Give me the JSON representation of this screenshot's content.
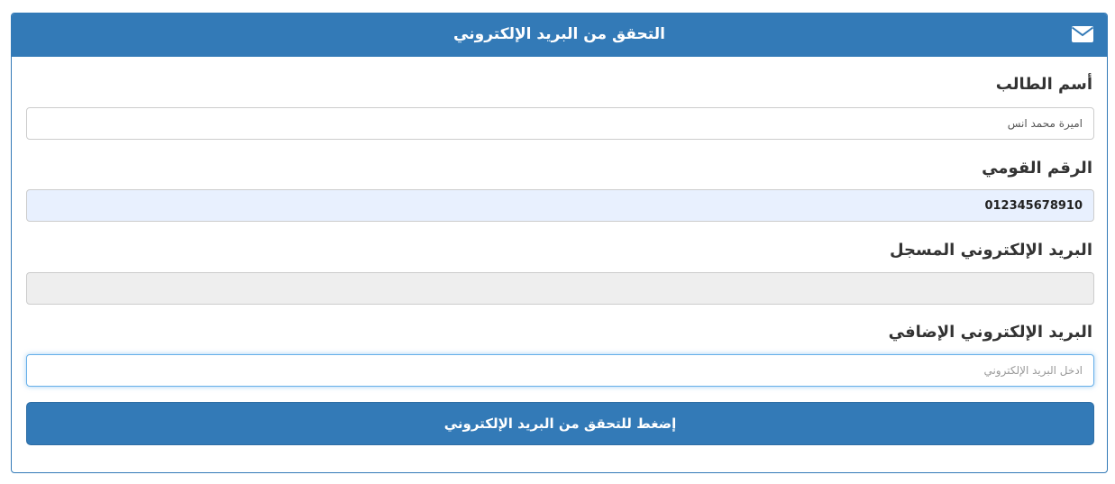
{
  "panel": {
    "title": "التحقق من البريد الإلكتروني",
    "header_icon": "envelope-icon",
    "accent_color": "#337ab7"
  },
  "form": {
    "student_name": {
      "label": "أسم الطالب",
      "value": "اميرة محمد انس"
    },
    "national_id": {
      "label": "الرقم القومي",
      "value": "012345678910"
    },
    "registered_email": {
      "label": "البريد الإلكتروني المسجل",
      "value": ""
    },
    "additional_email": {
      "label": "البريد الإلكتروني الإضافي",
      "value": "",
      "placeholder": "ادخل البريد الإلكتروني"
    },
    "submit_label": "إضغط للتحقق من البريد الإلكتروني"
  }
}
